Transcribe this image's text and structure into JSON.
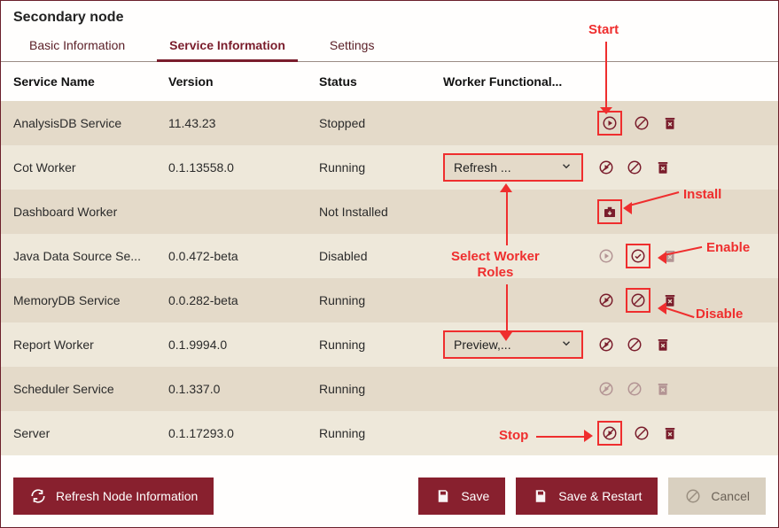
{
  "title": "Secondary node",
  "tabs": [
    {
      "label": "Basic Information",
      "active": false
    },
    {
      "label": "Service Information",
      "active": true
    },
    {
      "label": "Settings",
      "active": false
    }
  ],
  "columns": {
    "c0": "Service Name",
    "c1": "Version",
    "c2": "Status",
    "c3": "Worker Functional..."
  },
  "rows": [
    {
      "name": "AnalysisDB Service",
      "version": "11.43.23",
      "status": "Stopped",
      "role": "",
      "actions": [
        "start",
        "disable",
        "delete"
      ],
      "highlight": "start"
    },
    {
      "name": "Cot Worker",
      "version": "0.1.13558.0",
      "status": "Running",
      "role": "Refresh ...",
      "actions": [
        "stop",
        "disable",
        "delete"
      ]
    },
    {
      "name": "Dashboard Worker",
      "version": "",
      "status": "Not Installed",
      "role": "",
      "actions": [
        "install"
      ],
      "highlight": "install"
    },
    {
      "name": "Java Data Source Se...",
      "version": "0.0.472-beta",
      "status": "Disabled",
      "role": "",
      "actions": [
        "start-dim",
        "enable",
        "delete-dim"
      ],
      "highlight": "enable"
    },
    {
      "name": "MemoryDB Service",
      "version": "0.0.282-beta",
      "status": "Running",
      "role": "",
      "actions": [
        "stop",
        "disable",
        "delete"
      ],
      "highlight": "disable"
    },
    {
      "name": "Report Worker",
      "version": "0.1.9994.0",
      "status": "Running",
      "role": "Preview,...",
      "actions": [
        "stop",
        "disable",
        "delete"
      ]
    },
    {
      "name": "Scheduler Service",
      "version": "0.1.337.0",
      "status": "Running",
      "role": "",
      "actions": [
        "stop",
        "disable",
        "delete"
      ],
      "dim": true
    },
    {
      "name": "Server",
      "version": "0.1.17293.0",
      "status": "Running",
      "role": "",
      "actions": [
        "stop",
        "disable",
        "delete"
      ],
      "highlight": "stop"
    }
  ],
  "footer": {
    "refresh": "Refresh Node Information",
    "save": "Save",
    "saveRestart": "Save & Restart",
    "cancel": "Cancel"
  },
  "annotations": {
    "start": "Start",
    "install": "Install",
    "enable": "Enable",
    "disable": "Disable",
    "stop": "Stop",
    "roles": "Select Worker\nRoles"
  }
}
